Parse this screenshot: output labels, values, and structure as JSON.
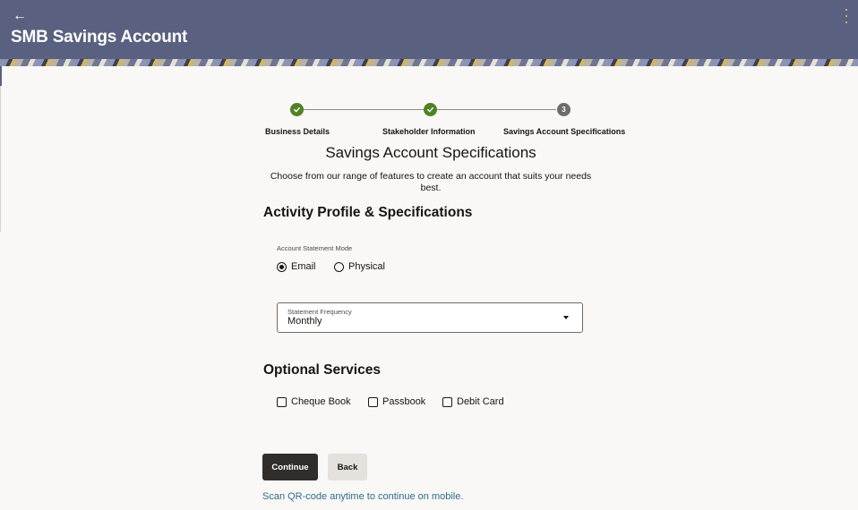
{
  "header": {
    "title": "SMB Savings Account",
    "back_icon": "back-arrow-icon",
    "menu_icon": "kebab-menu-icon"
  },
  "stepper": {
    "steps": [
      {
        "label": "Business Details",
        "status": "completed"
      },
      {
        "label": "Stakeholder Information",
        "status": "completed"
      },
      {
        "label": "Savings Account Specifications",
        "status": "current",
        "number": "3"
      }
    ]
  },
  "page": {
    "title": "Savings Account Specifications",
    "subtitle": "Choose from our range of features to create an account that suits your needs best."
  },
  "activity": {
    "heading": "Activity Profile & Specifications",
    "statement_mode_label": "Account Statement Mode",
    "options": [
      {
        "label": "Email",
        "selected": true
      },
      {
        "label": "Physical",
        "selected": false
      }
    ],
    "frequency": {
      "label": "Statement Frequency",
      "value": "Monthly"
    }
  },
  "optional": {
    "heading": "Optional Services",
    "services": [
      {
        "label": "Cheque Book",
        "checked": false
      },
      {
        "label": "Passbook",
        "checked": false
      },
      {
        "label": "Debit Card",
        "checked": false
      }
    ]
  },
  "actions": {
    "continue_label": "Continue",
    "back_label": "Back"
  },
  "qr_text": "Scan QR-code anytime to continue on mobile.",
  "colors": {
    "header_bg": "#5a607f",
    "step_done": "#508223",
    "step_current": "#6f6c67",
    "primary_button": "#312d2a",
    "link": "#2e6c89"
  }
}
